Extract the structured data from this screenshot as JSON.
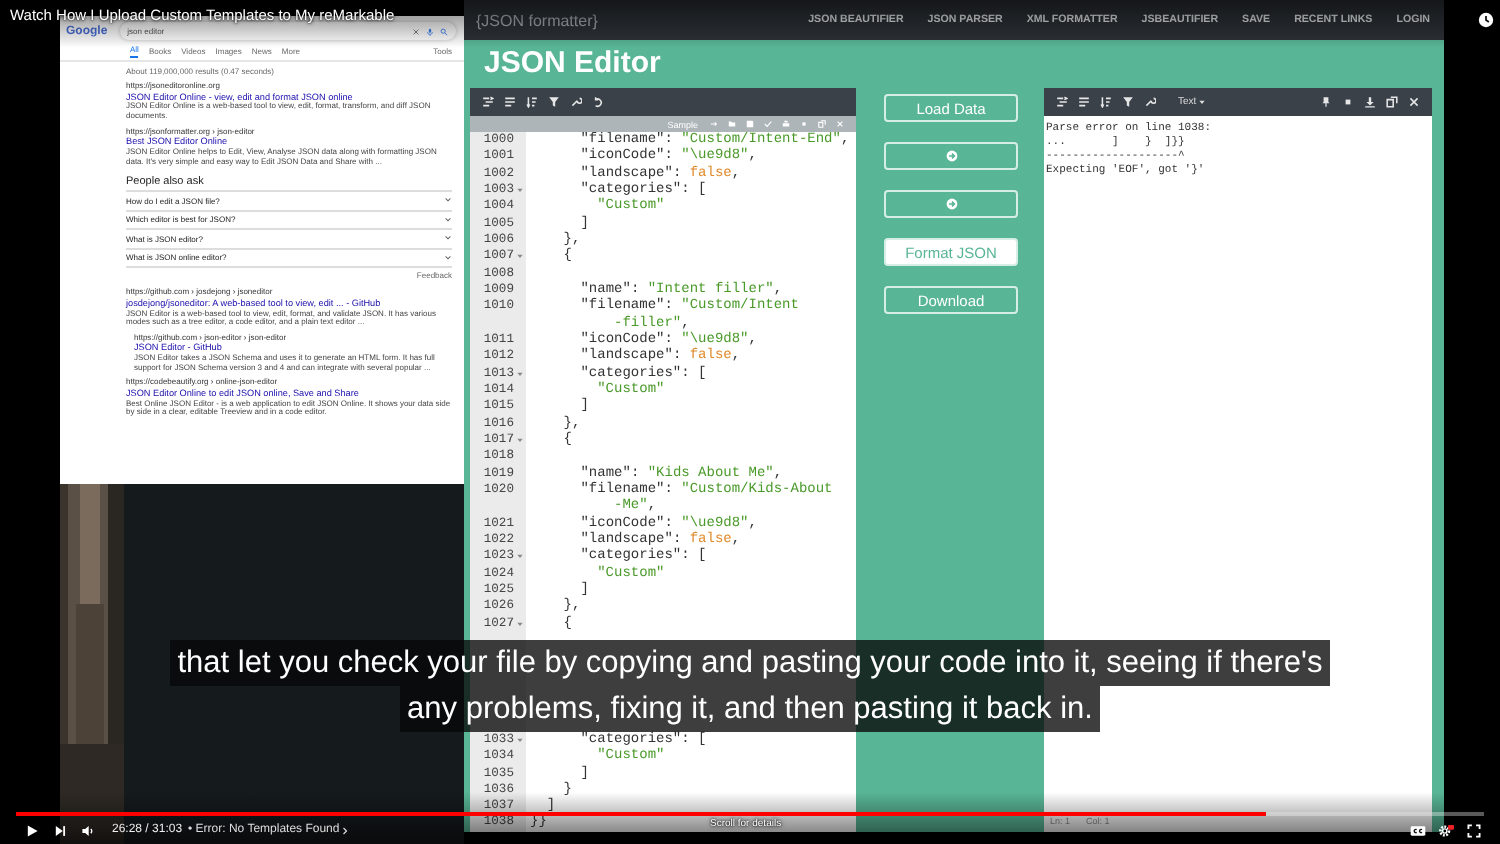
{
  "player": {
    "title": "Watch How I Upload Custom Templates to My reMarkable",
    "caption_lines": [
      "that let you check your file by copying and pasting your code into it, seeing if there's",
      "any problems, fixing it, and then pasting it back in."
    ],
    "progress": {
      "level": 0.852
    },
    "time": "26:28 / 31:03",
    "chapter": "• Error: No Templates Found",
    "hint": "Scroll for details"
  },
  "search_page": {
    "logo": "Google",
    "query": "json editor",
    "tabs": [
      {
        "label": "All",
        "selected": true
      },
      {
        "label": "Books",
        "selected": false
      },
      {
        "label": "Videos",
        "selected": false
      },
      {
        "label": "Images",
        "selected": false
      },
      {
        "label": "News",
        "selected": false
      },
      {
        "label": "More",
        "selected": false
      }
    ],
    "tools": "Tools",
    "stats": "About 119,000,000 results (0.47 seconds)",
    "results_top": [
      {
        "url": "https://jsoneditoronline.org",
        "title": "JSON Editor Online - view, edit and format JSON online",
        "snippet": "JSON Editor Online is a web-based tool to view, edit, format, transform, and diff JSON documents.",
        "indented": false
      },
      {
        "url": "https://jsonformatter.org › json-editor",
        "title": "Best JSON Editor Online",
        "snippet": "JSON Editor Online helps to Edit, View, Analyse JSON data along with formatting JSON data. It's very simple and easy way to Edit JSON Data and Share with ...",
        "indented": false
      }
    ],
    "people_also_ask": {
      "heading": "People also ask",
      "questions": [
        "How do I edit a JSON file?",
        "Which editor is best for JSON?",
        "What is JSON editor?",
        "What is JSON online editor?"
      ],
      "feedback": "Feedback"
    },
    "results_bottom": [
      {
        "url": "https://github.com › josdejong › jsoneditor",
        "title": "josdejong/jsoneditor: A web-based tool to view, edit ... - GitHub",
        "snippet": "JSON Editor is a web-based tool to view, edit, format, and validate JSON. It has various modes such as a tree editor, a code editor, and a plain text editor ...",
        "indented": false
      },
      {
        "url": "https://github.com › json-editor › json-editor",
        "title": "JSON Editor - GitHub",
        "snippet": "JSON Editor takes a JSON Schema and uses it to generate an HTML form. It has full support for JSON Schema version 3 and 4 and can integrate with several popular ...",
        "indented": true
      },
      {
        "url": "https://codebeautify.org › online-json-editor",
        "title": "JSON Editor Online to edit JSON online, Save and Share",
        "snippet": "Best Online JSON Editor - is a web application to edit JSON Online. It shows your data side by side in a clear, editable Treeview and in a code editor.",
        "indented": false
      }
    ]
  },
  "site": {
    "logo": "{JSON formatter}",
    "nav": [
      "JSON BEAUTIFIER",
      "JSON PARSER",
      "XML FORMATTER",
      "JSBEAUTIFIER",
      "SAVE",
      "RECENT LINKS",
      "LOGIN"
    ],
    "heading": "JSON Editor",
    "editor": {
      "sample": "Sample",
      "lines_top": [
        {
          "n": "1000",
          "code": "      \"filename\": \"Custom/Intent-End\",",
          "fold": false
        },
        {
          "n": "1001",
          "code": "      \"iconCode\": \"\\ue9d8\",",
          "fold": false
        },
        {
          "n": "1002",
          "code": "      \"landscape\": false,",
          "fold": false
        },
        {
          "n": "1003",
          "code": "      \"categories\": [",
          "fold": true
        },
        {
          "n": "1004",
          "code": "        \"Custom\"",
          "fold": false
        },
        {
          "n": "1005",
          "code": "      ]",
          "fold": false
        },
        {
          "n": "1006",
          "code": "    },",
          "fold": false
        },
        {
          "n": "1007",
          "code": "    {",
          "fold": true
        },
        {
          "n": "1008",
          "fold": false
        },
        {
          "n": "1009",
          "code": "      \"name\": \"Intent filler\",",
          "fold": false
        },
        {
          "n": "1010",
          "code": "      \"filename\": \"Custom/Intent",
          "wrap": "-filler\",",
          "fold": false
        },
        {
          "n": "1011",
          "code": "      \"iconCode\": \"\\ue9d8\",",
          "fold": false
        },
        {
          "n": "1012",
          "code": "      \"landscape\": false,",
          "fold": false
        },
        {
          "n": "1013",
          "code": "      \"categories\": [",
          "fold": true
        },
        {
          "n": "1014",
          "code": "        \"Custom\"",
          "fold": false
        },
        {
          "n": "1015",
          "code": "      ]",
          "fold": false
        },
        {
          "n": "1016",
          "code": "    },",
          "fold": false
        },
        {
          "n": "1017",
          "code": "    {",
          "fold": true
        },
        {
          "n": "1018",
          "fold": false
        },
        {
          "n": "1019",
          "code": "      \"name\": \"Kids About Me\",",
          "fold": false
        },
        {
          "n": "1020",
          "code": "      \"filename\": \"Custom/Kids-About",
          "wrap": "-Me\",",
          "fold": false
        },
        {
          "n": "1021",
          "code": "      \"iconCode\": \"\\ue9d8\",",
          "fold": false
        },
        {
          "n": "1022",
          "code": "      \"landscape\": false,",
          "fold": false
        },
        {
          "n": "1023",
          "code": "      \"categories\": [",
          "fold": true
        },
        {
          "n": "1024",
          "code": "        \"Custom\"",
          "fold": false
        },
        {
          "n": "1025",
          "code": "      ]",
          "fold": false
        },
        {
          "n": "1026",
          "code": "    },",
          "fold": false
        },
        {
          "n": "1027",
          "code": "    {",
          "fold": true
        }
      ],
      "lines_bottom": [
        {
          "n": "1033",
          "code": "      \"categories\": [",
          "fold": true
        },
        {
          "n": "1034",
          "code": "        \"Custom\"",
          "fold": false
        },
        {
          "n": "1035",
          "code": "      ]",
          "fold": false
        },
        {
          "n": "1036",
          "code": "    }",
          "fold": false
        },
        {
          "n": "1037",
          "code": "  ]",
          "fold": false
        },
        {
          "n": "1038",
          "code": "}}",
          "fold": false
        }
      ]
    },
    "actions": [
      {
        "kind": "text",
        "label": "Load Data",
        "primary": false
      },
      {
        "kind": "icon"
      },
      {
        "kind": "icon"
      },
      {
        "kind": "text",
        "label": "Format JSON",
        "primary": true
      },
      {
        "kind": "text",
        "label": "Download",
        "primary": false
      }
    ],
    "output": {
      "mode": "Text",
      "lines": [
        "Parse error on line 1038:",
        "...       ]    }  ]}}",
        "--------------------^",
        "Expecting 'EOF', got '}'"
      ],
      "status": [
        "Ln: 1",
        "Col: 1"
      ]
    }
  }
}
